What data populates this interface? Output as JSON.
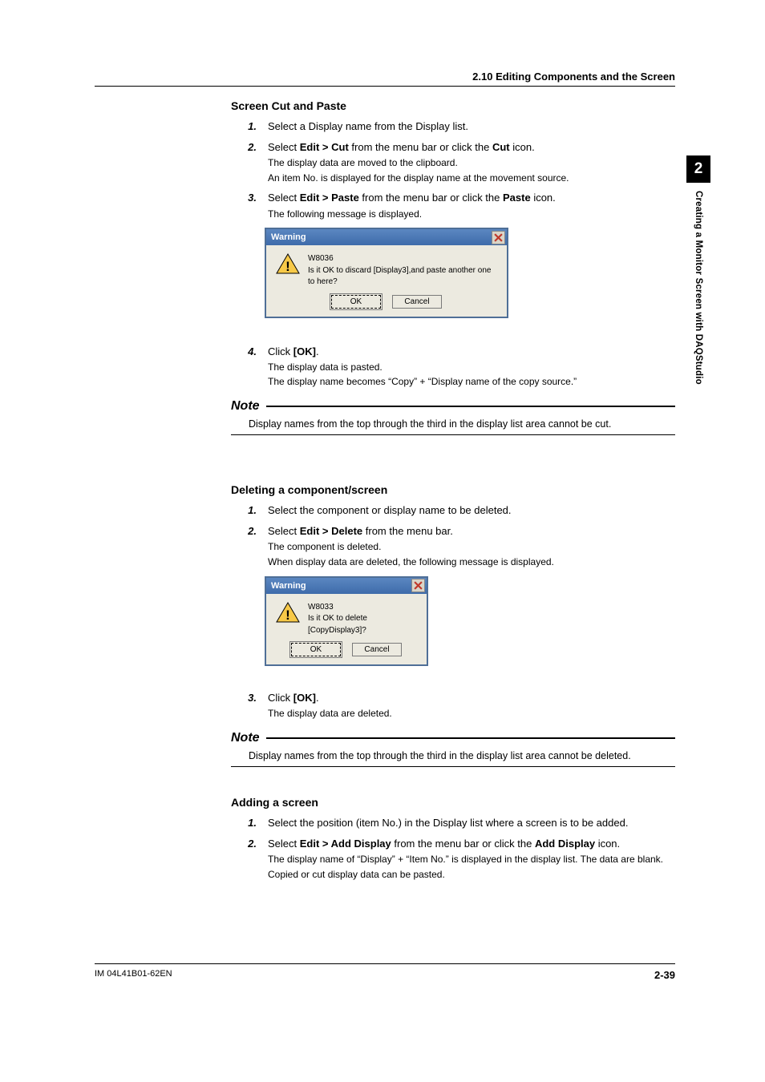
{
  "header": {
    "section": "2.10  Editing Components and the Screen"
  },
  "sideTab": {
    "chapterNum": "2",
    "chapterTitle": "Creating a Monitor Screen with DAQStudio"
  },
  "footer": {
    "docId": "IM 04L41B01-62EN",
    "page": "2-39"
  },
  "blockA": {
    "title": "Screen Cut and Paste",
    "steps": [
      {
        "num": "1.",
        "main": "Select a Display name from the Display list."
      },
      {
        "num": "2.",
        "pre": "Select ",
        "b1": "Edit > Cut",
        "mid": " from the menu bar or click the ",
        "b2": "Cut",
        "post": " icon.",
        "sub1": "The display data are moved to the clipboard.",
        "sub2": "An item No. is displayed for the display name at the movement source."
      },
      {
        "num": "3.",
        "pre": "Select ",
        "b1": "Edit > Paste",
        "mid": " from the menu bar or click the ",
        "b2": "Paste",
        "post": " icon.",
        "sub1": "The following message is displayed."
      }
    ],
    "dialog": {
      "title": "Warning",
      "code": "W8036",
      "msg": "Is it OK to discard [Display3],and paste another one to here?",
      "ok": "OK",
      "cancel": "Cancel"
    },
    "step4": {
      "num": "4.",
      "pre": "Click ",
      "b1": "[OK]",
      "post": ".",
      "sub1": "The display data is pasted.",
      "sub2": "The display name becomes “Copy” + “Display name of the copy source.”"
    },
    "note": {
      "label": "Note",
      "body": "Display names from the top through the third in the display list area cannot be cut."
    }
  },
  "blockB": {
    "title": "Deleting a component/screen",
    "steps": [
      {
        "num": "1.",
        "main": "Select the component or display name to be deleted."
      },
      {
        "num": "2.",
        "pre": "Select ",
        "b1": "Edit > Delete",
        "post": " from the menu bar.",
        "sub1": "The component is deleted.",
        "sub2": "When display data are deleted, the following message is displayed."
      }
    ],
    "dialog": {
      "title": "Warning",
      "code": "W8033",
      "msg": "Is it OK to delete [CopyDisplay3]?",
      "ok": "OK",
      "cancel": "Cancel"
    },
    "step3": {
      "num": "3.",
      "pre": "Click ",
      "b1": "[OK]",
      "post": ".",
      "sub1": "The display data are deleted."
    },
    "note": {
      "label": "Note",
      "body": "Display names from the top through the third in the display list area cannot be deleted."
    }
  },
  "blockC": {
    "title": "Adding a screen",
    "steps": [
      {
        "num": "1.",
        "main": "Select the position (item No.) in the Display list where a screen is to be added."
      },
      {
        "num": "2.",
        "pre": "Select ",
        "b1": "Edit > Add Display",
        "mid": " from the menu bar or click the ",
        "b2": "Add Display",
        "post": " icon.",
        "sub1": "The display name of “Display” + “Item No.” is displayed in the display list. The data are blank.",
        "sub2": "Copied or cut display data can be pasted."
      }
    ]
  }
}
